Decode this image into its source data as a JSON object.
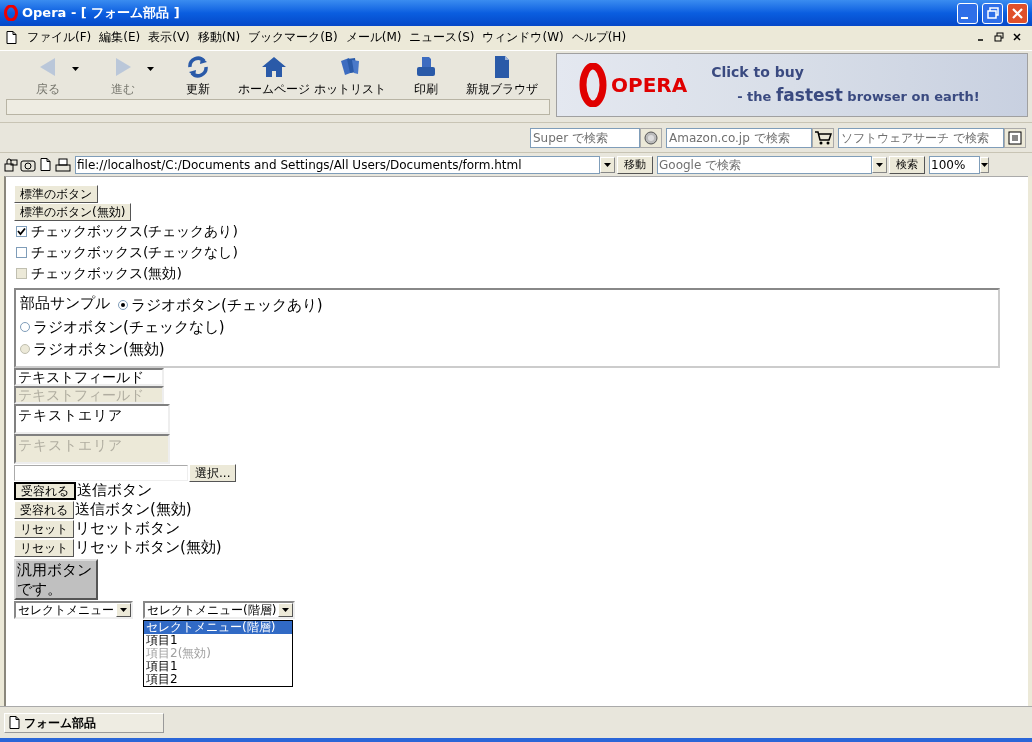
{
  "window": {
    "title": "Opera - [ フォーム部品 ]"
  },
  "menu": [
    "ファイル(F)",
    "編集(E)",
    "表示(V)",
    "移動(N)",
    "ブックマーク(B)",
    "メール(M)",
    "ニュース(S)",
    "ウィンドウ(W)",
    "ヘルプ(H)"
  ],
  "toolbar": [
    {
      "kind": "back",
      "label": "戻る",
      "disabled": true,
      "dropdown": true
    },
    {
      "kind": "forward",
      "label": "進む",
      "disabled": true,
      "dropdown": true
    },
    {
      "kind": "reload",
      "label": "更新",
      "disabled": false,
      "dropdown": false
    },
    {
      "kind": "home",
      "label": "ホームページ",
      "disabled": false,
      "dropdown": false
    },
    {
      "kind": "hotlist",
      "label": "ホットリスト",
      "disabled": false,
      "dropdown": false
    },
    {
      "kind": "print",
      "label": "印刷",
      "disabled": false,
      "dropdown": false
    },
    {
      "kind": "new",
      "label": "新規ブラウザ",
      "disabled": false,
      "dropdown": false
    }
  ],
  "banner": {
    "logo": "OPERA",
    "line1": "Click to buy",
    "line2": "- the **fastest** browser on earth!"
  },
  "search_fields": [
    {
      "kind": "globe",
      "placeholder": "Super で検索"
    },
    {
      "kind": "cart",
      "placeholder": "Amazon.co.jp で検索"
    },
    {
      "kind": "software",
      "placeholder": "ソフトウェアサーチ で検索"
    }
  ],
  "address_bar": {
    "url": "file://localhost/C:/Documents and Settings/All Users/Documents/form.html",
    "go_button": "移動",
    "search_placeholder": "Google で検索",
    "search_button": "検索",
    "zoom": "100%"
  },
  "page": [
    {
      "kind": "button",
      "label": "標準のボタン"
    },
    {
      "kind": "button",
      "label": "標準のボタン(無効)"
    },
    {
      "kind": "checkbox",
      "label": "チェックボックス(チェックあり)",
      "checked": true,
      "disabled": false
    },
    {
      "kind": "checkbox",
      "label": "チェックボックス(チェックなし)",
      "checked": false,
      "disabled": false
    },
    {
      "kind": "checkbox",
      "label": "チェックボックス(無効)",
      "checked": false,
      "disabled": true
    },
    {
      "kind": "fieldset",
      "legend": "部品サンプル",
      "radios": [
        {
          "label": "ラジオボタン(チェックあり)",
          "selected": true,
          "disabled": false
        },
        {
          "label": "ラジオボタン(チェックなし)",
          "selected": false,
          "disabled": false
        },
        {
          "label": "ラジオボタン(無効)",
          "selected": false,
          "disabled": true
        }
      ]
    },
    {
      "kind": "textfield",
      "value": "テキストフィールド",
      "disabled": false
    },
    {
      "kind": "textfield",
      "value": "テキストフィールド",
      "disabled": true
    },
    {
      "kind": "textarea",
      "value": "テキストエリア",
      "disabled": false
    },
    {
      "kind": "textarea",
      "value": "テキストエリア",
      "disabled": true
    },
    {
      "kind": "file",
      "button": "選択..."
    },
    {
      "kind": "submit",
      "button": "受容れる",
      "label": "送信ボタン",
      "focused": true
    },
    {
      "kind": "submit",
      "button": "受容れる",
      "label": "送信ボタン(無効)",
      "focused": false
    },
    {
      "kind": "submit",
      "button": "リセット",
      "label": "リセットボタン",
      "focused": false
    },
    {
      "kind": "submit",
      "button": "リセット",
      "label": "リセットボタン(無効)",
      "focused": false
    },
    {
      "kind": "bigbutton",
      "label": "汎用ボタンです。"
    },
    {
      "kind": "selects",
      "selects": [
        {
          "value": "セレクトメニュー"
        },
        {
          "value": "セレクトメニュー(階層)",
          "options": [
            {
              "label": "セレクトメニュー(階層)",
              "selected": true,
              "disabled": false
            },
            {
              "label": "項目1",
              "selected": false,
              "disabled": false
            },
            {
              "label": "項目2(無効)",
              "selected": false,
              "disabled": true
            },
            {
              "label": "項目1",
              "selected": false,
              "disabled": false
            },
            {
              "label": "項目2",
              "selected": false,
              "disabled": false
            }
          ]
        }
      ]
    }
  ],
  "status_bar": {
    "tab": "フォーム部品"
  }
}
